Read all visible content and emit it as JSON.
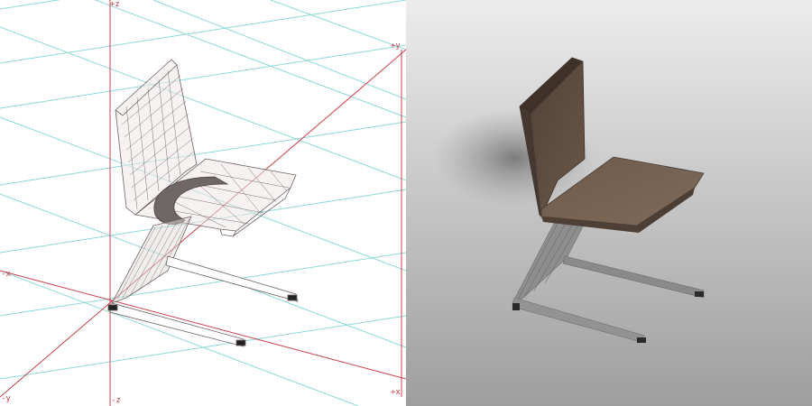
{
  "wireframe_view": {
    "axis_labels": {
      "plus_z": "+z",
      "minus_z": "-z",
      "plus_y": "+y",
      "minus_y": "-y",
      "plus_x": "+x",
      "minus_x": "-x"
    },
    "colors": {
      "background": "#ffffff",
      "grid": "#8fd8d8",
      "axis": "#c8404a",
      "wire": "#6e6262",
      "label": "#c8404a"
    }
  },
  "render_view": {
    "colors": {
      "background_top": "#ececec",
      "background_bottom": "#9e9e9e",
      "upholstery": "#5b4b3f",
      "upholstery_light": "#7a6656",
      "frame": "#8c8c8c",
      "shadow": "#7c7c7c"
    }
  }
}
